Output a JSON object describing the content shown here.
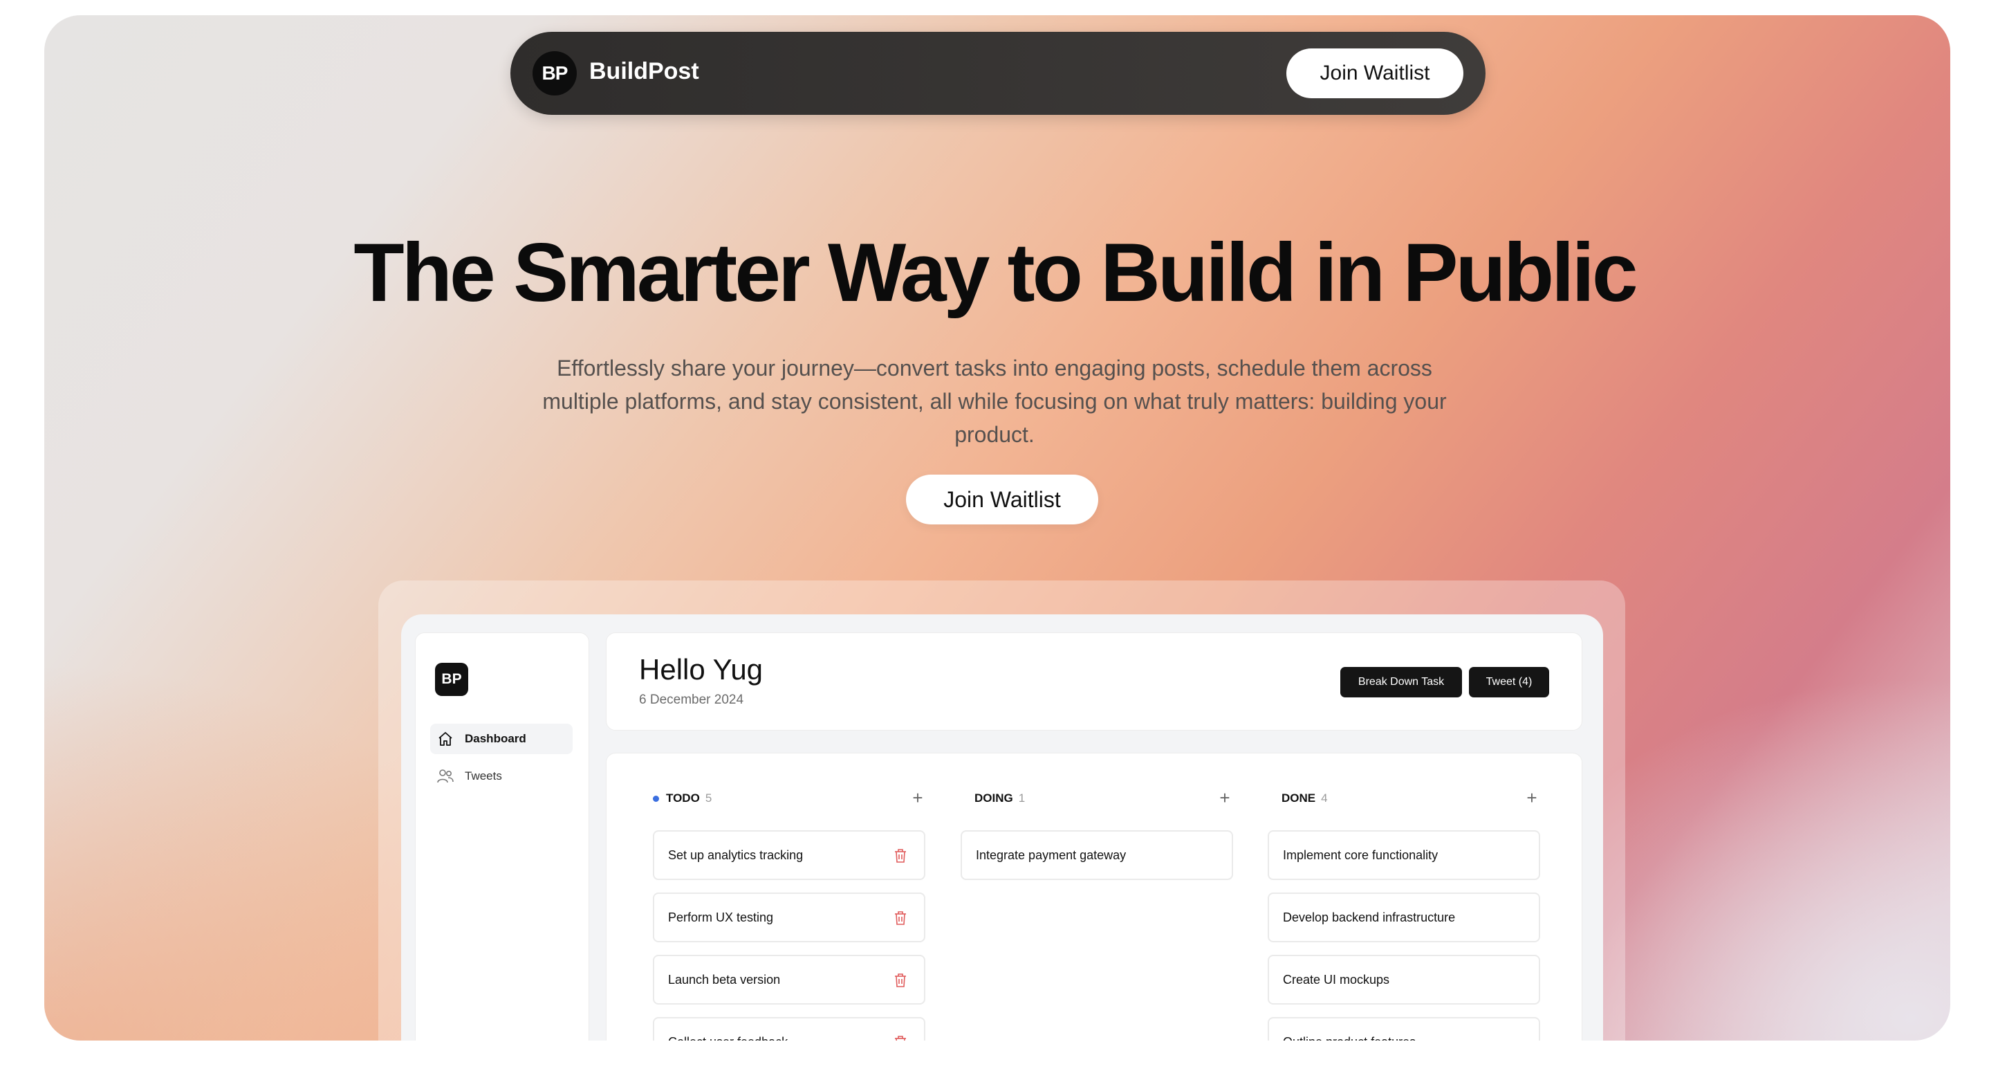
{
  "nav": {
    "logo_text": "BP",
    "brand": "BuildPost",
    "cta_label": "Join Waitlist"
  },
  "hero": {
    "headline": "The Smarter Way to Build in Public",
    "subheadline": "Effortlessly share your journey—convert tasks into engaging posts, schedule them across multiple platforms, and stay consistent, all while focusing on what truly matters: building your product.",
    "cta_label": "Join Waitlist"
  },
  "app": {
    "sidebar": {
      "logo_text": "BP",
      "items": [
        {
          "label": "Dashboard",
          "icon": "home-icon",
          "active": true
        },
        {
          "label": "Tweets",
          "icon": "users-icon",
          "active": false
        }
      ]
    },
    "header": {
      "greeting": "Hello Yug",
      "date": "6 December 2024",
      "break_down_label": "Break Down Task",
      "tweet_label": "Tweet (4)"
    },
    "columns": [
      {
        "title": "TODO",
        "count": "5",
        "cards": [
          "Set up analytics tracking",
          "Perform UX testing",
          "Launch beta version",
          "Collect user feedback"
        ]
      },
      {
        "title": "DOING",
        "count": "1",
        "cards": [
          "Integrate payment gateway"
        ]
      },
      {
        "title": "DONE",
        "count": "4",
        "cards": [
          "Implement core functionality",
          "Develop backend infrastructure",
          "Create UI mockups",
          "Outline product features"
        ]
      }
    ],
    "add_symbol": "+"
  },
  "colors": {
    "accent_dot": "#3b6fe0",
    "delete_icon": "#e05a5a",
    "dark_button": "#151515"
  }
}
